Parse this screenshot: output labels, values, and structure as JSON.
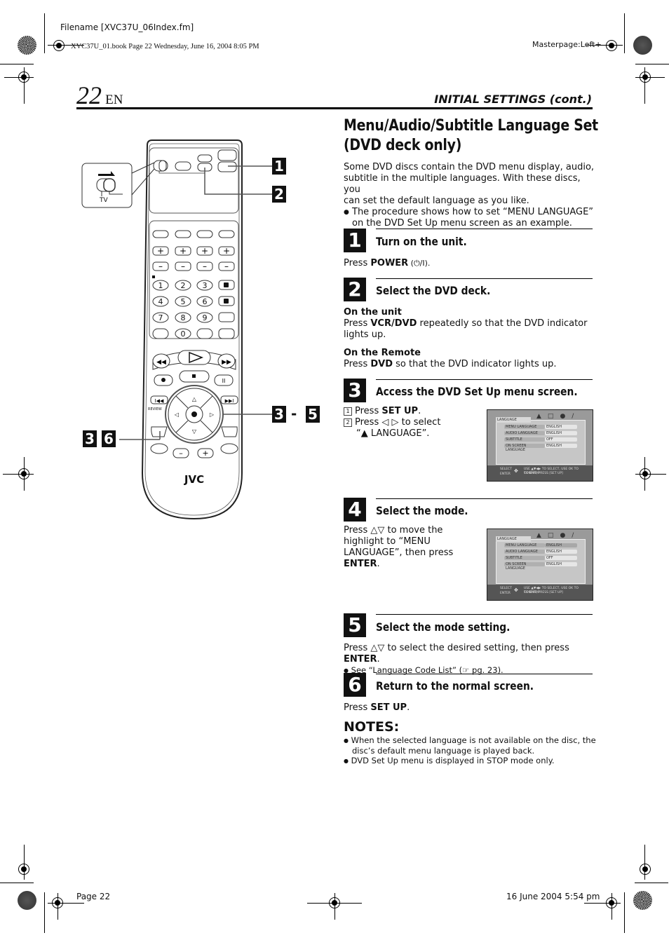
{
  "print_marks": {
    "filename": "Filename [XVC37U_06Index.fm]",
    "book_info": "XVC37U_01.book  Page 22  Wednesday, June 16, 2004  8:05 PM",
    "masterpage": "Masterpage:Left+",
    "footer_page": "Page 22",
    "footer_date": "16 June 2004 5:54 pm"
  },
  "header": {
    "page_number": "22",
    "language": "EN",
    "section": "INITIAL SETTINGS (cont.)"
  },
  "article": {
    "title_line1": "Menu/Audio/Subtitle Language Set",
    "title_line2": "(DVD deck only)",
    "intro_line1": "Some DVD discs contain the DVD menu display, audio,",
    "intro_line2": "subtitle in the multiple languages. With these discs, you",
    "intro_line3": "can set the default language as you like.",
    "bullet_line1": "The procedure shows how to set “MENU LANGUAGE”",
    "bullet_line2": "on the DVD Set Up menu screen as an example."
  },
  "steps": [
    {
      "number": "1",
      "heading": "Turn on the unit.",
      "text_pre": "Press ",
      "text_bold": "POWER",
      "text_post": " (⏻/I)."
    },
    {
      "number": "2",
      "heading": "Select the DVD deck.",
      "unit_label": "On the unit",
      "unit_pre": "Press ",
      "unit_bold": "VCR/DVD",
      "unit_post1": " repeatedly so that the DVD indicator",
      "unit_post2": "lights up.",
      "remote_label": "On the Remote",
      "remote_pre": "Press ",
      "remote_bold": "DVD",
      "remote_post": " so that the DVD indicator lights up."
    },
    {
      "number": "3",
      "heading": "Access the DVD Set Up menu screen.",
      "sub1_num": "1",
      "sub1_pre": "Press ",
      "sub1_bold": "SET UP",
      "sub1_post": ".",
      "sub2_num": "2",
      "sub2_line1": "Press ◁ ▷ to select",
      "sub2_line2": "“▲ LANGUAGE”."
    },
    {
      "number": "4",
      "heading": "Select the mode.",
      "line1": "Press △▽ to move the",
      "line2": "highlight to “MENU",
      "line3": "LANGUAGE”, then press",
      "line4_bold": "ENTER",
      "line4_post": "."
    },
    {
      "number": "5",
      "heading": "Select the mode setting.",
      "text_pre": "Press △▽ to select the desired setting, then press ",
      "text_bold": "ENTER",
      "text_post": ".",
      "bullet": "See “Language Code List” (☞ pg. 23)."
    },
    {
      "number": "6",
      "heading": "Return to the normal screen.",
      "text_pre": "Press ",
      "text_bold": "SET UP",
      "text_post": "."
    }
  ],
  "notes": {
    "title": "NOTES:",
    "items": [
      "When the selected language is not available on the disc, the",
      "disc’s default menu language is played back.",
      "DVD Set Up menu is displayed in STOP mode only."
    ]
  },
  "dvd_menu_screen": {
    "tab": "LANGUAGE",
    "icons": [
      "language-icon",
      "picture-icon",
      "audio-icon",
      "settings-icon"
    ],
    "rows": [
      {
        "label": "MENU LANGUAGE",
        "value": "ENGLISH"
      },
      {
        "label": "AUDIO LANGUAGE",
        "value": "ENGLISH"
      },
      {
        "label": "SUBTITLE",
        "value": "OFF"
      },
      {
        "label": "ON SCREEN LANGUAGE",
        "value": "ENGLISH"
      }
    ],
    "footer_select": "SELECT",
    "footer_enter": "ENTER",
    "footer_hint1": "USE ▲▼◀▶ TO SELECT, USE OK TO CONFIRM",
    "footer_hint2": "TO EXIT, PRESS [SET UP]"
  },
  "remote": {
    "brand": "JVC",
    "tv_label": "TV",
    "review_label": "REVIEW",
    "keypad": [
      "1",
      "2",
      "3",
      "4",
      "5",
      "6",
      "7",
      "8",
      "9",
      "0"
    ],
    "callouts": {
      "c1": "1",
      "c2": "2",
      "c3a": "3",
      "dash": "-",
      "c5": "5",
      "c3b": "3",
      "c6": "6"
    }
  }
}
